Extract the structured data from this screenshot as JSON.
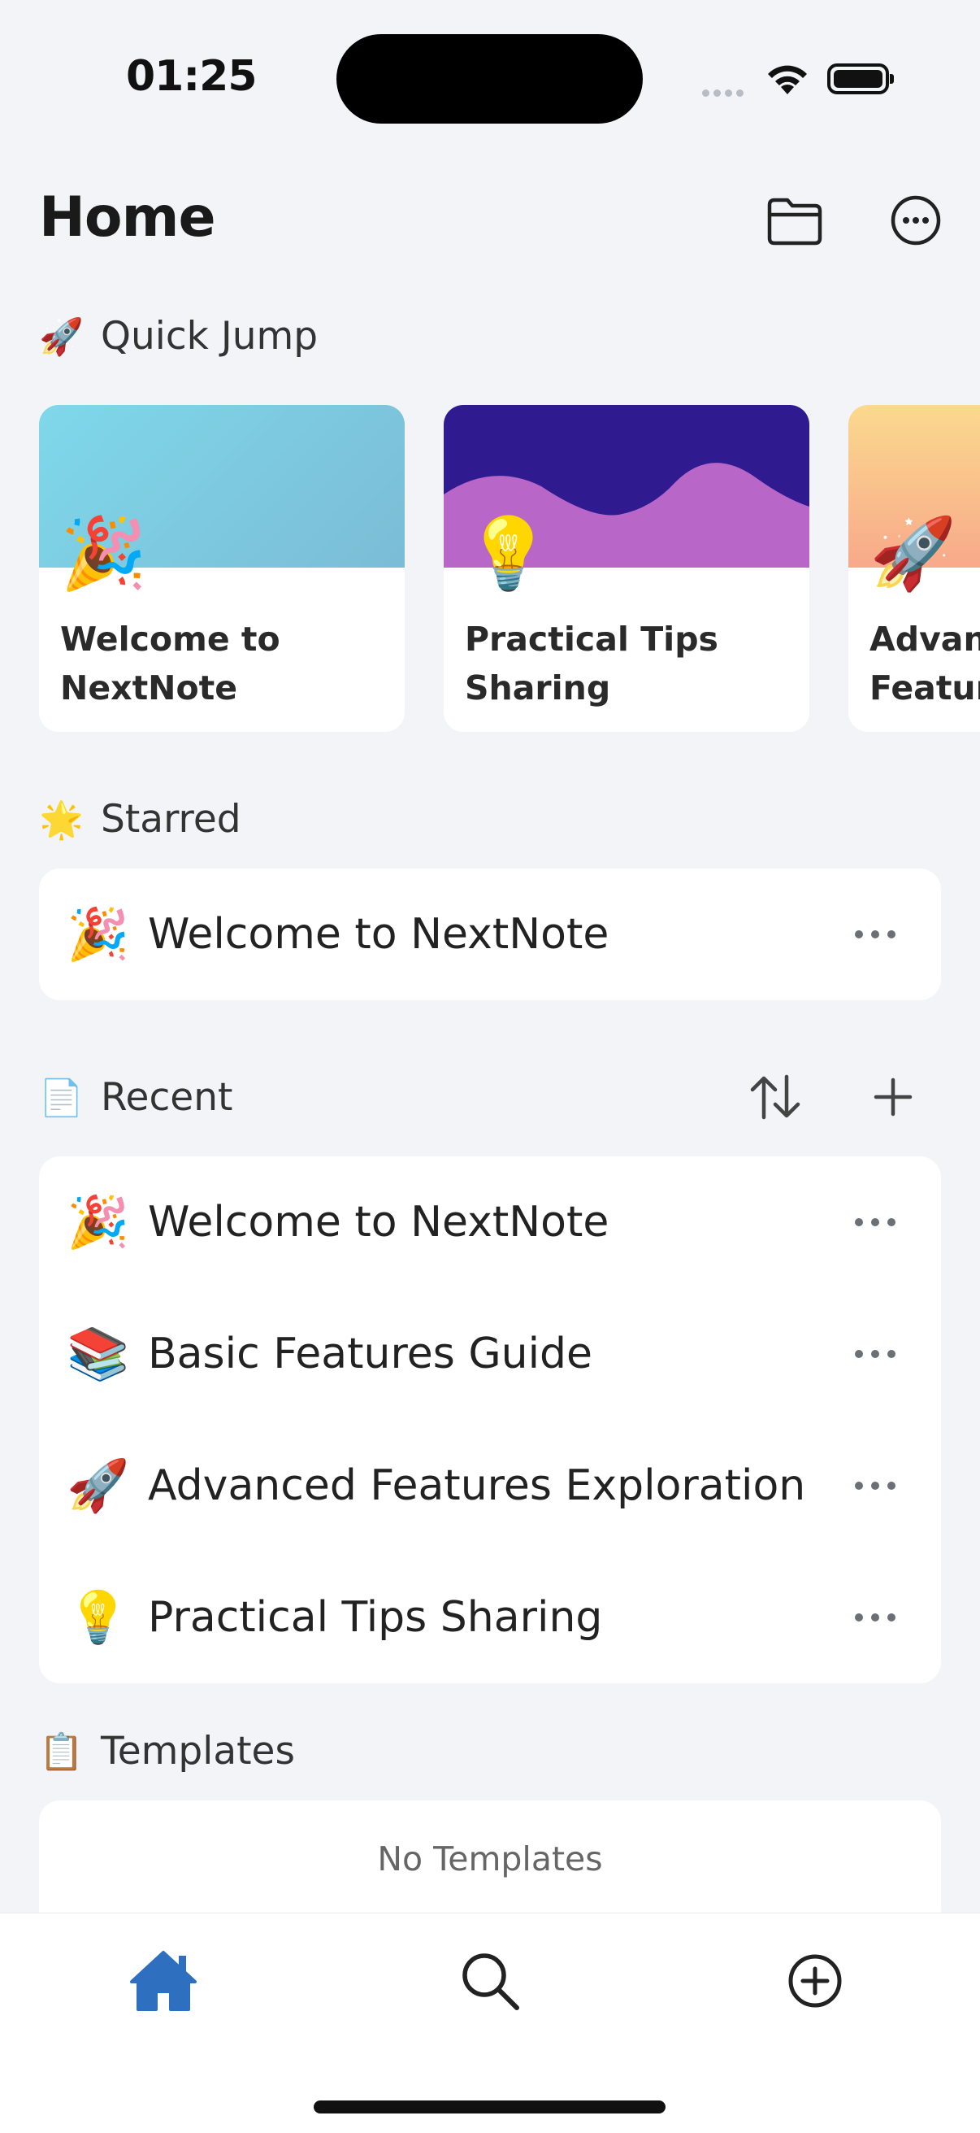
{
  "status_bar": {
    "time": "01:25"
  },
  "header": {
    "title": "Home"
  },
  "quick_jump": {
    "heading": "Quick Jump",
    "heading_icon": "🚀",
    "cards": [
      {
        "title": "Welcome to\nNextNote",
        "emoji": "🎉"
      },
      {
        "title": "Practical Tips\nSharing",
        "emoji": "💡"
      },
      {
        "title": "Advanced\nFeatures",
        "emoji": "🚀"
      }
    ]
  },
  "starred": {
    "heading": "Starred",
    "heading_icon": "🌟",
    "items": [
      {
        "emoji": "🎉",
        "label": "Welcome to NextNote"
      }
    ]
  },
  "recent": {
    "heading": "Recent",
    "heading_icon": "📄",
    "items": [
      {
        "emoji": "🎉",
        "label": "Welcome to NextNote"
      },
      {
        "emoji": "📚",
        "label": "Basic Features Guide"
      },
      {
        "emoji": "🚀",
        "label": "Advanced Features Exploration"
      },
      {
        "emoji": "💡",
        "label": "Practical Tips Sharing"
      }
    ]
  },
  "templates": {
    "heading": "Templates",
    "heading_icon": "📋",
    "empty_text": "No Templates"
  },
  "tabs": [
    {
      "name": "home",
      "icon": "home-icon"
    },
    {
      "name": "search",
      "icon": "search-icon"
    },
    {
      "name": "new",
      "icon": "add-circle-icon"
    }
  ],
  "colors": {
    "accent": "#2f6fc0",
    "background": "#f2f4f8"
  }
}
